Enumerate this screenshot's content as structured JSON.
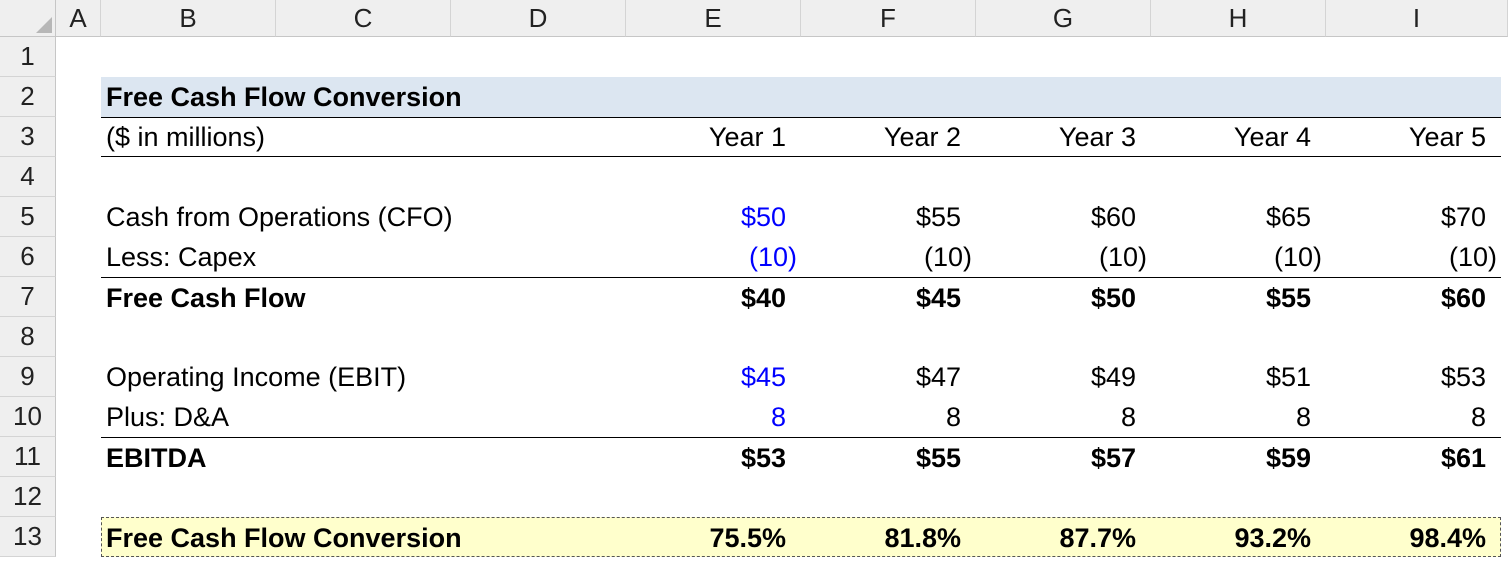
{
  "columns": [
    "A",
    "B",
    "C",
    "D",
    "E",
    "F",
    "G",
    "H",
    "I"
  ],
  "rows": [
    "1",
    "2",
    "3",
    "4",
    "5",
    "6",
    "7",
    "8",
    "9",
    "10",
    "11",
    "12",
    "13"
  ],
  "table": {
    "title": "Free Cash Flow Conversion",
    "units": "($ in millions)",
    "years": [
      "Year 1",
      "Year 2",
      "Year 3",
      "Year 4",
      "Year 5"
    ],
    "cfo": {
      "label": "Cash from Operations (CFO)",
      "values": [
        "$50",
        "$55",
        "$60",
        "$65",
        "$70"
      ]
    },
    "capex": {
      "label": "Less: Capex",
      "values": [
        "(10)",
        "(10)",
        "(10)",
        "(10)",
        "(10)"
      ]
    },
    "fcf": {
      "label": "Free Cash Flow",
      "values": [
        "$40",
        "$45",
        "$50",
        "$55",
        "$60"
      ]
    },
    "ebit": {
      "label": "Operating Income (EBIT)",
      "values": [
        "$45",
        "$47",
        "$49",
        "$51",
        "$53"
      ]
    },
    "da": {
      "label": "Plus: D&A",
      "values": [
        "8",
        "8",
        "8",
        "8",
        "8"
      ]
    },
    "ebitda": {
      "label": "EBITDA",
      "values": [
        "$53",
        "$55",
        "$57",
        "$59",
        "$61"
      ]
    },
    "conversion": {
      "label": "Free Cash Flow Conversion",
      "values": [
        "75.5%",
        "81.8%",
        "87.7%",
        "93.2%",
        "98.4%"
      ]
    }
  },
  "colors": {
    "input_blue": "#0000ff",
    "title_band": "#dce6f1",
    "highlight": "#ffffcc"
  }
}
